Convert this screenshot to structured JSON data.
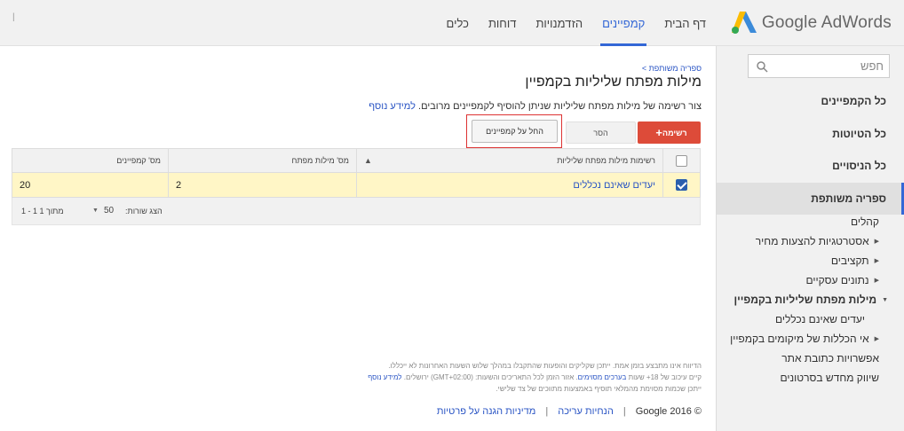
{
  "app": {
    "logo_text": "Google AdWords",
    "corner_mark": "|"
  },
  "nav": {
    "tabs": [
      {
        "label": "דף הבית"
      },
      {
        "label": "קמפיינים",
        "active": true
      },
      {
        "label": "הזדמנויות"
      },
      {
        "label": "דוחות"
      },
      {
        "label": "כלים"
      }
    ]
  },
  "sidebar": {
    "search_placeholder": "חפש",
    "sections": [
      {
        "label": "כל הקמפיינים"
      },
      {
        "label": "כל הטיוטות"
      },
      {
        "label": "כל הניסויים"
      },
      {
        "label": "ספריה משותפת",
        "selected": true
      }
    ],
    "library_items": [
      {
        "label": "קהלים",
        "arrow": false
      },
      {
        "label": "אסטרטגיות להצעות מחיר",
        "arrow": true
      },
      {
        "label": "תקציבים",
        "arrow": true
      },
      {
        "label": "נתונים עסקיים",
        "arrow": true
      },
      {
        "label": "מילות מפתח שליליות בקמפיין",
        "arrow": true,
        "expanded": true,
        "bold": true
      },
      {
        "label": "יעדים שאינם נכללים",
        "sub": true
      },
      {
        "label": "אי הכללות של מיקומים בקמפיין",
        "arrow": true
      },
      {
        "label": "אפשרויות כתובת אתר",
        "arrow": false
      },
      {
        "label": "שיווק מחדש בסרטונים",
        "arrow": false
      }
    ]
  },
  "main": {
    "breadcrumb": "ספריה משותפת >",
    "title": "מילות מפתח שליליות בקמפיין",
    "description": "צור רשימה של מילות מפתח שליליות שניתן להוסיף לקמפיינים מרובים.",
    "learn_more": "למידע נוסף",
    "buttons": {
      "add": "רשימה",
      "remove": "הסר",
      "apply": "החל על קמפיינים"
    },
    "table": {
      "headers": [
        "רשימות מילות מפתח שליליות",
        "מס' מילות מפתח",
        "מס' קמפיינים"
      ],
      "rows": [
        {
          "name": "יעדים שאינם נכללים",
          "keywords": "2",
          "campaigns": "20",
          "checked": true
        }
      ]
    },
    "pager": {
      "label": "הצג שורות:",
      "rows_value": "50",
      "range": "1 - 1 מתוך 1"
    },
    "footnotes": {
      "line1": "הדיווח אינו מתבצע בזמן אמת. ייתכן שקליקים והופעות שהתקבלו במהלך שלוש השעות האחרונות לא ייכללו.",
      "line2_a": "קיים עיכוב של 18+ שעות",
      "line2_link": "בערכים מסוימים",
      "line2_b": ". אזור הזמן לכל התאריכים והשעות: (GMT+02:00) ירושלים.",
      "line2_learn": "למידע נוסף",
      "line3": "ייתכן שכמות מסוימת מהמלאי תוסיף באמצעות מתווכים של צד שלישי."
    },
    "footer": {
      "copyright": "© 2016 Google",
      "editorial": "הנחיות עריכה",
      "privacy": "מדיניות הגנה על פרטיות"
    }
  },
  "colors": {
    "accent": "#3367d6",
    "add_button": "#dd4b39",
    "selected_row": "#fff6c6",
    "highlight_frame": "#dd3333"
  }
}
